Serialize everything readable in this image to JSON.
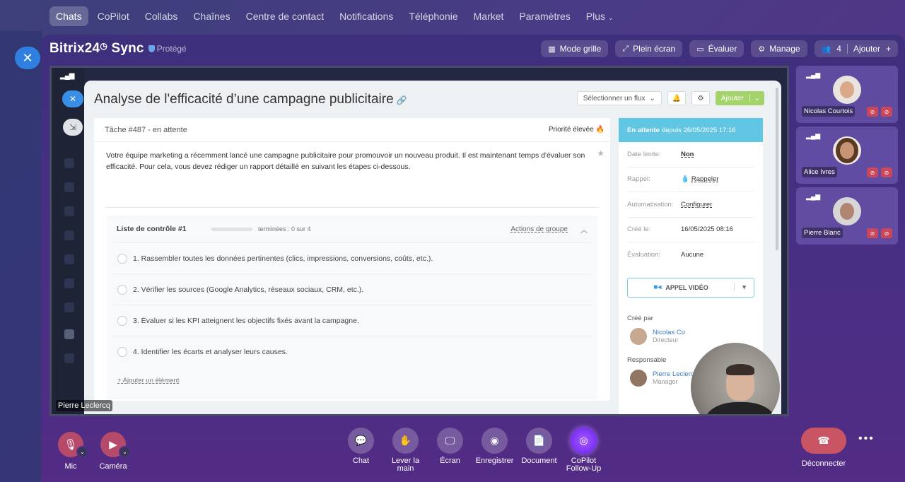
{
  "topnav": {
    "items": [
      "Chats",
      "CoPilot",
      "Collabs",
      "Chaînes",
      "Centre de contact",
      "Notifications",
      "Téléphonie",
      "Market",
      "Paramètres",
      "Plus"
    ]
  },
  "call": {
    "brand": "Bitrix24",
    "brand_suffix": "Sync",
    "protected_label": "Protégé",
    "tools": {
      "grid": "Mode grille",
      "fullscreen": "Plein écran",
      "rate": "Évaluer",
      "manage": "Manage",
      "participants_count": "4",
      "add": "Ajouter"
    }
  },
  "screen": {
    "presenter_name": "Pierre Leclercq",
    "task": {
      "title": "Analyse de l'efficacité d’une campagne publicitaire",
      "flux_select": "Sélectionner un flux",
      "add_button": "Ajouter",
      "header": "Tâche #487 - en attente",
      "priority": "Priorité élevée",
      "description": "Votre équipe marketing a récemment lancé une campagne publicitaire pour promouvoir un nouveau produit. Il est maintenant temps d'évaluer son efficacité. Pour cela, vous devez rédiger un rapport détaillé en suivant les étapes ci-dessous.",
      "checklist": {
        "title": "Liste de contrôle #1",
        "progress": "terminées : 0 sur 4",
        "group_actions": "Actions de groupe",
        "items": [
          "1. Rassembler toutes les données pertinentes (clics, impressions, conversions, coûts, etc.).",
          "2. Vérifier les sources (Google Analytics, réseaux sociaux, CRM, etc.).",
          "3. Évaluer si les KPI atteignent les objectifs fixés avant la campagne.",
          "4. Identifier les écarts et analyser leurs causes."
        ],
        "add_item": "+ Ajouter un élément"
      },
      "sidebar": {
        "status_bold": "En attente",
        "status_rest": "depuis 26/05/2025 17:16",
        "rows": [
          {
            "k": "Date limite:",
            "v": "Non"
          },
          {
            "k": "Rappel:",
            "v": "Rappeler"
          },
          {
            "k": "Automatisation:",
            "v": "Configurer"
          },
          {
            "k": "Créé le:",
            "v": "16/05/2025 08:16"
          },
          {
            "k": "Évaluation:",
            "v": "Aucune"
          }
        ],
        "video_call": "APPEL VIDÉO",
        "created_by_label": "Créé par",
        "creator_name": "Nicolas Co",
        "creator_role": "Directeur",
        "responsible_label": "Responsable",
        "responsible_name": "Pierre Leclercq",
        "responsible_role": "Manager"
      }
    }
  },
  "participants": [
    {
      "name": "Nicolas Courtois"
    },
    {
      "name": "Alice Ivres"
    },
    {
      "name": "Pierre Blanc"
    }
  ],
  "controls": {
    "mic": "Mic",
    "camera": "Caméra",
    "chat": "Chat",
    "raise_hand_1": "Lever la",
    "raise_hand_2": "main",
    "screen": "Écran",
    "record": "Enregistrer",
    "document": "Document",
    "copilot_1": "CoPilot",
    "copilot_2": "Follow-Up",
    "disconnect": "Déconnecter"
  }
}
